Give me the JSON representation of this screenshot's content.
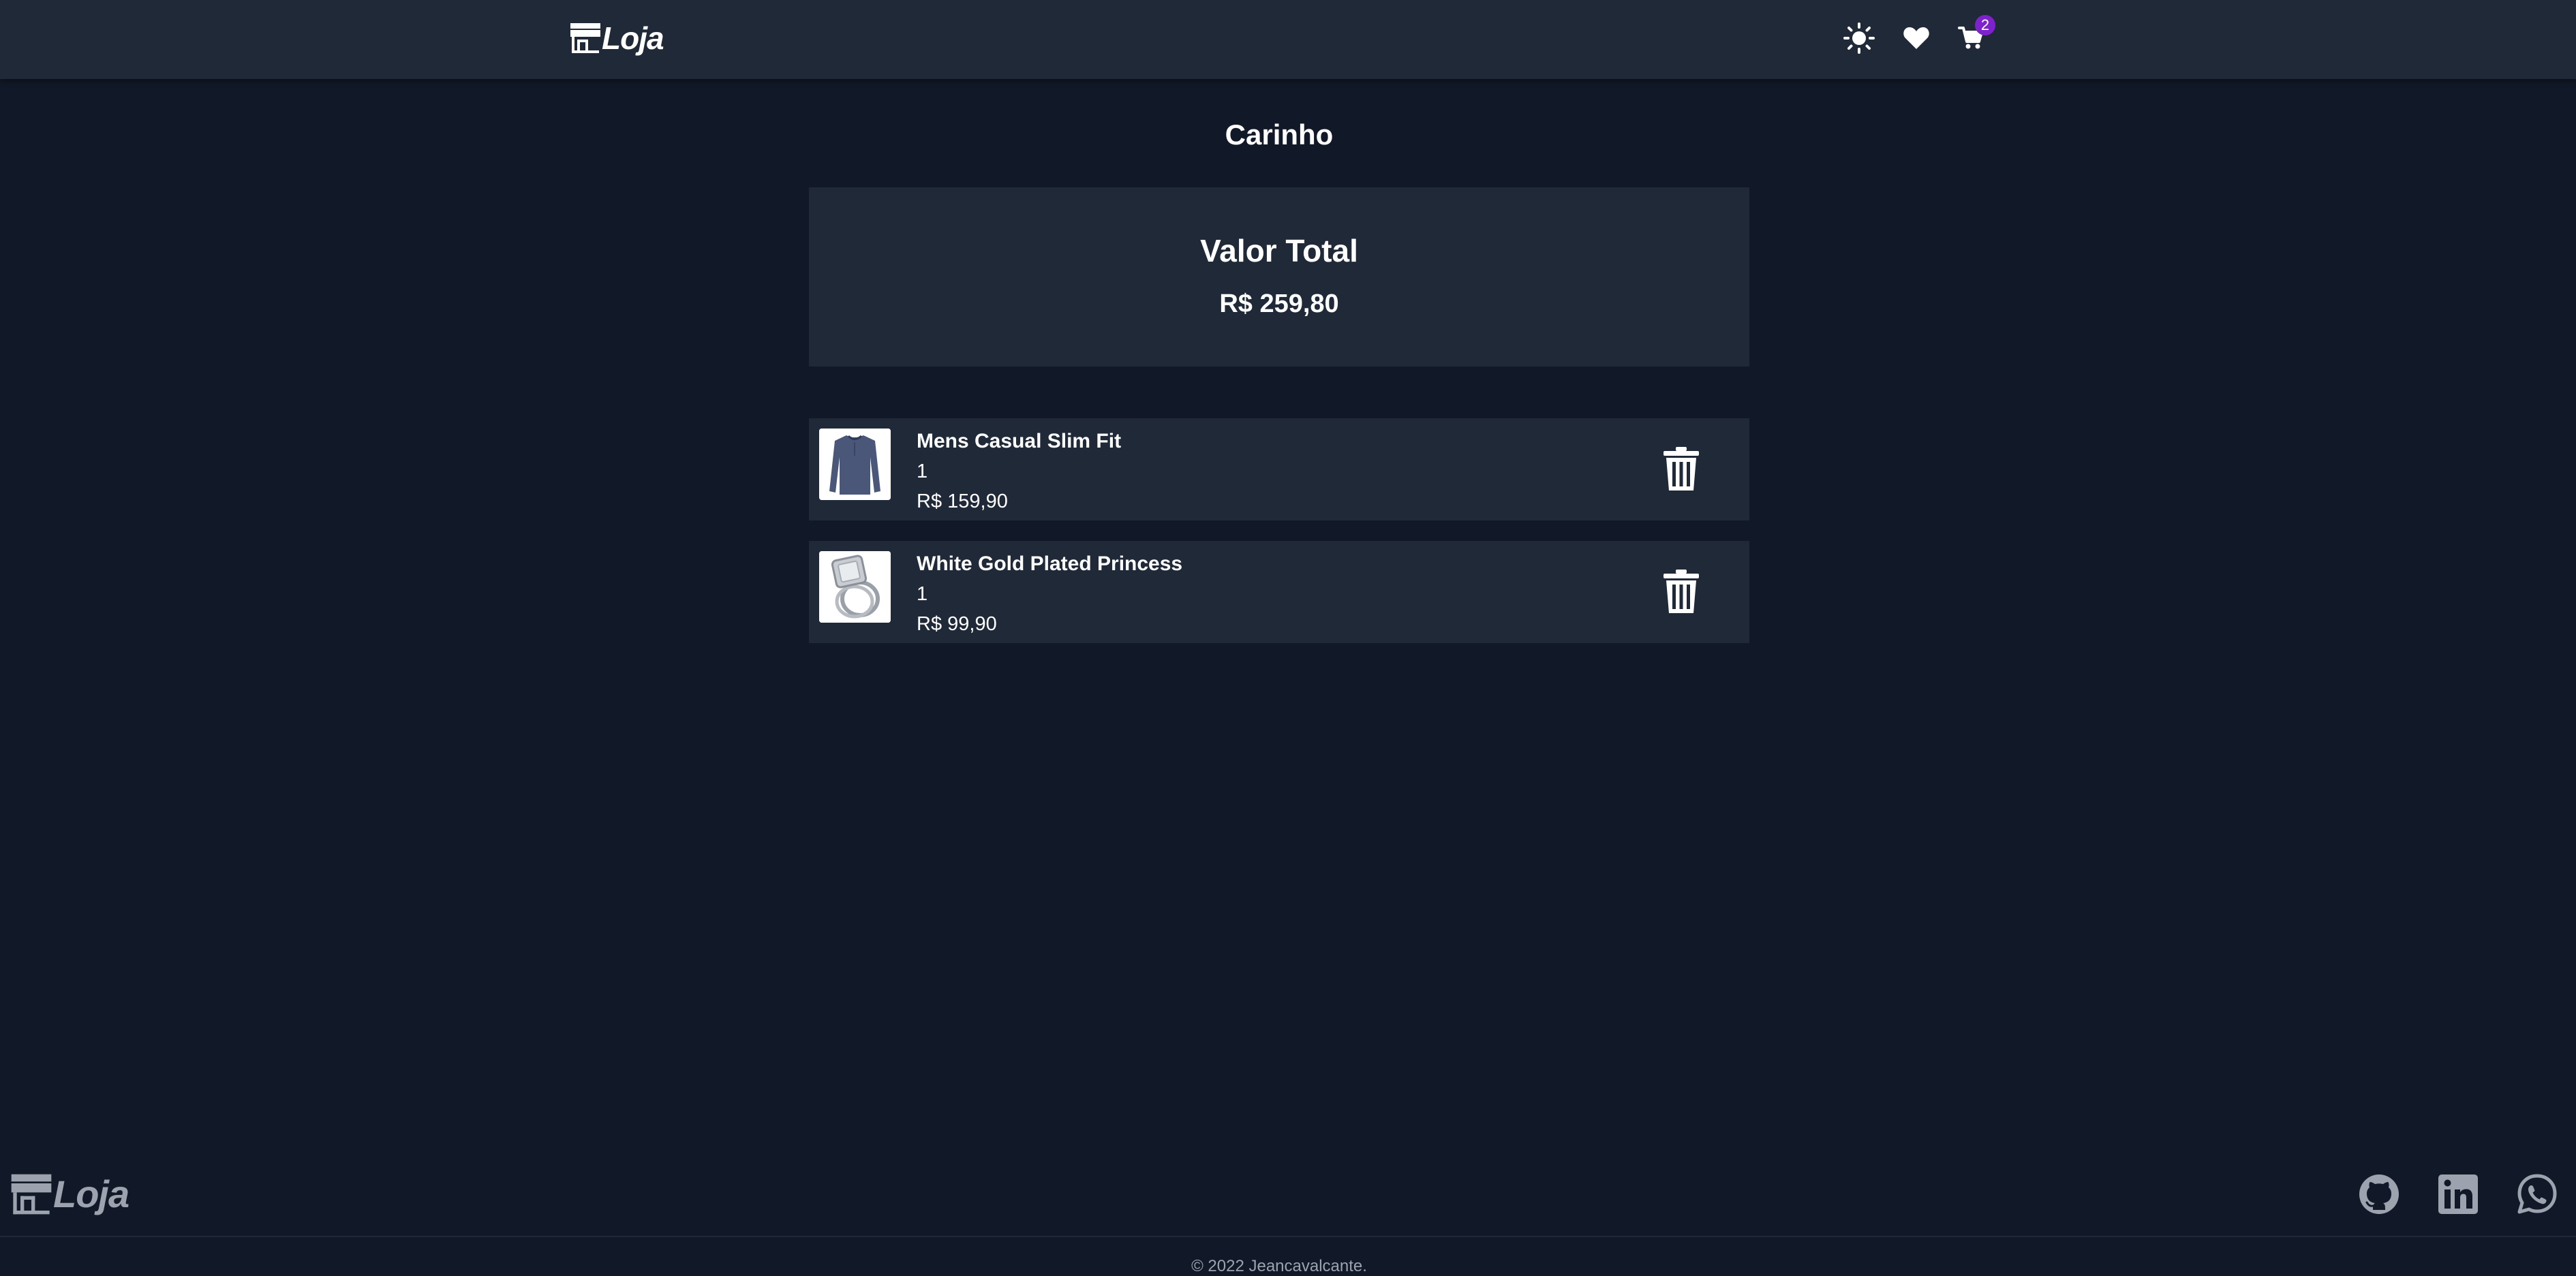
{
  "header": {
    "brand": "Loja",
    "cart_count": "2",
    "icons": [
      "store-icon",
      "sun-icon",
      "heart-icon",
      "cart-icon"
    ]
  },
  "page": {
    "title": "Carinho"
  },
  "summary": {
    "label": "Valor Total",
    "value": "R$ 259,80"
  },
  "cart": {
    "items": [
      {
        "name": "Mens Casual Slim Fit",
        "quantity": "1",
        "price": "R$ 159,90",
        "image": "long-sleeve-shirt"
      },
      {
        "name": "White Gold Plated Princess",
        "quantity": "1",
        "price": "R$ 99,90",
        "image": "ring"
      }
    ]
  },
  "footer": {
    "brand": "Loja",
    "copyright": "© 2022 Jeancavalcante.",
    "socials": [
      "github-icon",
      "linkedin-icon",
      "whatsapp-icon"
    ]
  },
  "colors": {
    "background": "#111827",
    "surface": "#1f2937",
    "badge": "#7e22ce",
    "muted": "#9ca3af"
  }
}
